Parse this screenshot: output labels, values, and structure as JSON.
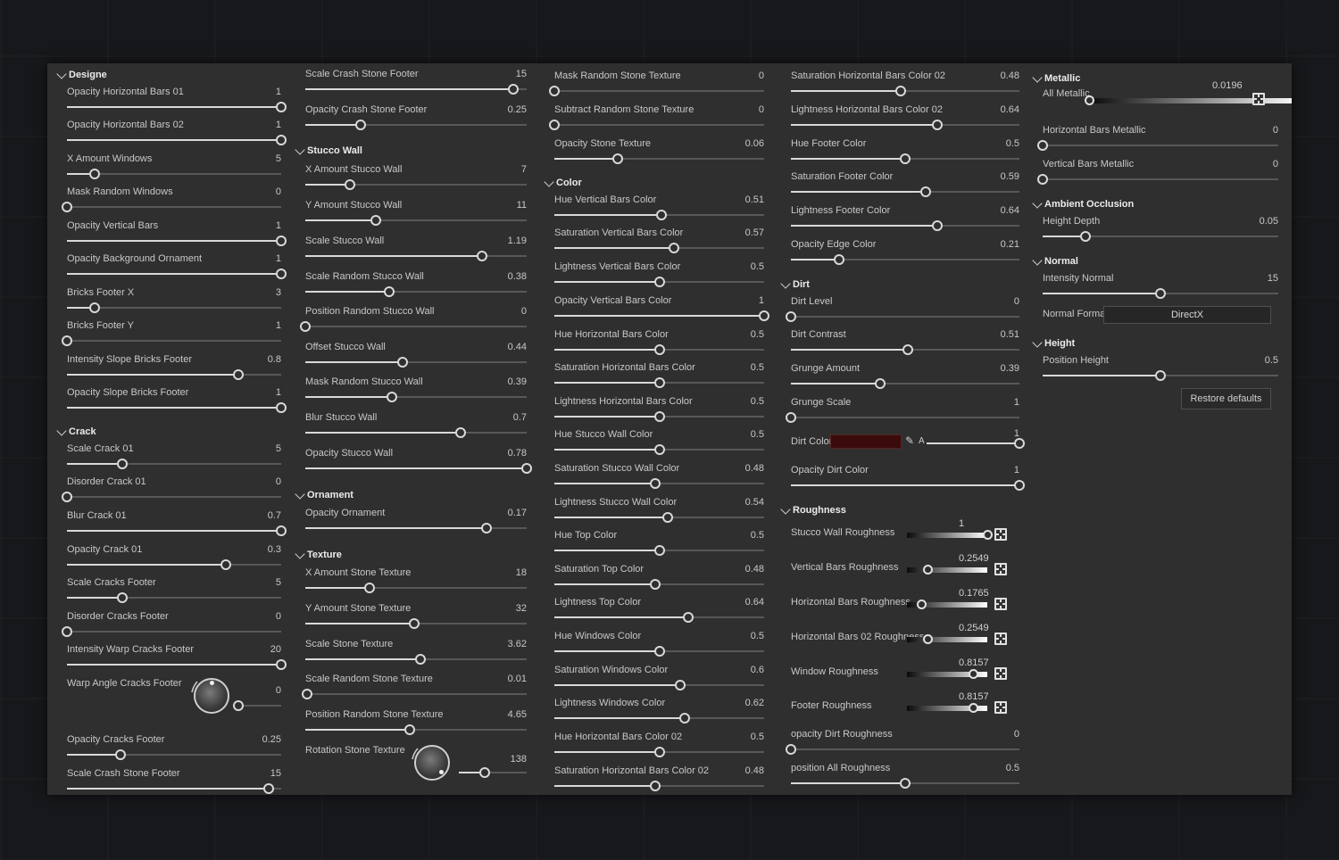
{
  "columns": [
    {
      "entries": [
        {
          "kind": "section",
          "title": "Designe"
        },
        {
          "kind": "slider",
          "label": "Opacity Horizontal Bars 01",
          "value": "1",
          "fraction": 1.0
        },
        {
          "kind": "slider",
          "label": "Opacity Horizontal Bars 02",
          "value": "1",
          "fraction": 1.0
        },
        {
          "kind": "slider",
          "label": "X Amount Windows",
          "value": "5",
          "fraction": 0.13
        },
        {
          "kind": "slider",
          "label": "Mask Random Windows",
          "value": "0",
          "fraction": 0.0
        },
        {
          "kind": "slider",
          "label": "Opacity Vertical Bars",
          "value": "1",
          "fraction": 1.0
        },
        {
          "kind": "slider",
          "label": "Opacity Background Ornament",
          "value": "1",
          "fraction": 1.0
        },
        {
          "kind": "slider",
          "label": "Bricks Footer X",
          "value": "3",
          "fraction": 0.13
        },
        {
          "kind": "slider",
          "label": "Bricks Footer Y",
          "value": "1",
          "fraction": 0.0
        },
        {
          "kind": "slider",
          "label": "Intensity Slope Bricks Footer",
          "value": "0.8",
          "fraction": 0.8
        },
        {
          "kind": "slider",
          "label": "Opacity Slope Bricks Footer",
          "value": "1",
          "fraction": 1.0
        },
        {
          "kind": "section",
          "title": "Crack"
        },
        {
          "kind": "slider",
          "label": "Scale Crack 01",
          "value": "5",
          "fraction": 0.26
        },
        {
          "kind": "slider",
          "label": "Disorder Crack 01",
          "value": "0",
          "fraction": 0.0
        },
        {
          "kind": "slider",
          "label": "Blur Crack 01",
          "value": "0.7",
          "fraction": 1.0
        },
        {
          "kind": "slider",
          "label": "Opacity Crack 01",
          "value": "0.3",
          "fraction": 0.74
        },
        {
          "kind": "slider",
          "label": "Scale Cracks Footer",
          "value": "5",
          "fraction": 0.26
        },
        {
          "kind": "slider",
          "label": "Disorder Cracks Footer",
          "value": "0",
          "fraction": 0.0
        },
        {
          "kind": "slider",
          "label": "Intensity Warp Cracks Footer",
          "value": "20",
          "fraction": 1.0
        },
        {
          "kind": "dial",
          "label": "Warp Angle Cracks Footer",
          "value": "0",
          "fraction": 0.0
        },
        {
          "kind": "slider",
          "label": "Opacity Cracks Footer",
          "value": "0.25",
          "fraction": 0.25
        },
        {
          "kind": "slider",
          "label": "Scale Crash Stone Footer",
          "value": "15",
          "fraction": 0.94
        }
      ]
    },
    {
      "entries": [
        {
          "kind": "slider",
          "label": "Scale Crash Stone Footer",
          "value": "15",
          "fraction": 0.94
        },
        {
          "kind": "slider",
          "label": "Opacity Crash Stone Footer",
          "value": "0.25",
          "fraction": 0.25
        },
        {
          "kind": "section",
          "title": "Stucco Wall"
        },
        {
          "kind": "slider",
          "label": "X Amount Stucco Wall",
          "value": "7",
          "fraction": 0.2
        },
        {
          "kind": "slider",
          "label": "Y Amount Stucco Wall",
          "value": "11",
          "fraction": 0.32
        },
        {
          "kind": "slider",
          "label": "Scale Stucco Wall",
          "value": "1.19",
          "fraction": 0.8
        },
        {
          "kind": "slider",
          "label": "Scale Random Stucco Wall",
          "value": "0.38",
          "fraction": 0.38
        },
        {
          "kind": "slider",
          "label": "Position Random Stucco Wall",
          "value": "0",
          "fraction": 0.0
        },
        {
          "kind": "slider",
          "label": "Offset Stucco Wall",
          "value": "0.44",
          "fraction": 0.44
        },
        {
          "kind": "slider",
          "label": "Mask Random Stucco Wall",
          "value": "0.39",
          "fraction": 0.39
        },
        {
          "kind": "slider",
          "label": "Blur Stucco Wall",
          "value": "0.7",
          "fraction": 0.7
        },
        {
          "kind": "slider",
          "label": "Opacity Stucco Wall",
          "value": "0.78",
          "fraction": 1.0
        },
        {
          "kind": "section",
          "title": "Ornament"
        },
        {
          "kind": "slider",
          "label": "Opacity Ornament",
          "value": "0.17",
          "fraction": 0.82
        },
        {
          "kind": "section",
          "title": "Texture"
        },
        {
          "kind": "slider",
          "label": "X Amount Stone Texture",
          "value": "18",
          "fraction": 0.29
        },
        {
          "kind": "slider",
          "label": "Y Amount Stone Texture",
          "value": "32",
          "fraction": 0.49
        },
        {
          "kind": "slider",
          "label": "Scale Stone Texture",
          "value": "3.62",
          "fraction": 0.52
        },
        {
          "kind": "slider",
          "label": "Scale Random Stone Texture",
          "value": "0.01",
          "fraction": 0.01
        },
        {
          "kind": "slider",
          "label": "Position Random Stone Texture",
          "value": "4.65",
          "fraction": 0.47
        },
        {
          "kind": "dial",
          "label": "Rotation Stone Texture",
          "value": "138",
          "fraction": 0.38
        }
      ]
    },
    {
      "entries": [
        {
          "kind": "slider",
          "label": "Mask Random Stone Texture",
          "value": "0",
          "fraction": 0.0
        },
        {
          "kind": "slider",
          "label": "Subtract Random Stone Texture",
          "value": "0",
          "fraction": 0.0
        },
        {
          "kind": "slider",
          "label": "Opacity Stone Texture",
          "value": "0.06",
          "fraction": 0.3
        },
        {
          "kind": "section",
          "title": "Color"
        },
        {
          "kind": "slider",
          "label": "Hue Vertical Bars Color",
          "value": "0.51",
          "fraction": 0.51
        },
        {
          "kind": "slider",
          "label": "Saturation Vertical Bars Color",
          "value": "0.57",
          "fraction": 0.57
        },
        {
          "kind": "slider",
          "label": "Lightness Vertical Bars Color",
          "value": "0.5",
          "fraction": 0.5
        },
        {
          "kind": "slider",
          "label": "Opacity Vertical Bars Color",
          "value": "1",
          "fraction": 1.0
        },
        {
          "kind": "slider",
          "label": "Hue Horizontal Bars Color",
          "value": "0.5",
          "fraction": 0.5
        },
        {
          "kind": "slider",
          "label": "Saturation Horizontal Bars Color",
          "value": "0.5",
          "fraction": 0.5
        },
        {
          "kind": "slider",
          "label": "Lightness Horizontal Bars Color",
          "value": "0.5",
          "fraction": 0.5
        },
        {
          "kind": "slider",
          "label": "Hue Stucco Wall Color",
          "value": "0.5",
          "fraction": 0.5
        },
        {
          "kind": "slider",
          "label": "Saturation Stucco Wall Color",
          "value": "0.48",
          "fraction": 0.48
        },
        {
          "kind": "slider",
          "label": "Lightness Stucco Wall Color",
          "value": "0.54",
          "fraction": 0.54
        },
        {
          "kind": "slider",
          "label": "Hue Top Color",
          "value": "0.5",
          "fraction": 0.5
        },
        {
          "kind": "slider",
          "label": "Saturation Top Color",
          "value": "0.48",
          "fraction": 0.48
        },
        {
          "kind": "slider",
          "label": "Lightness Top Color",
          "value": "0.64",
          "fraction": 0.64
        },
        {
          "kind": "slider",
          "label": "Hue Windows Color",
          "value": "0.5",
          "fraction": 0.5
        },
        {
          "kind": "slider",
          "label": "Saturation Windows Color",
          "value": "0.6",
          "fraction": 0.6
        },
        {
          "kind": "slider",
          "label": "Lightness Windows Color",
          "value": "0.62",
          "fraction": 0.62
        },
        {
          "kind": "slider",
          "label": "Hue  Horizontal Bars Color 02",
          "value": "0.5",
          "fraction": 0.5
        },
        {
          "kind": "slider",
          "label": "Saturation Horizontal Bars Color 02",
          "value": "0.48",
          "fraction": 0.48
        }
      ]
    },
    {
      "entries": [
        {
          "kind": "slider",
          "label": "Saturation Horizontal Bars Color 02",
          "value": "0.48",
          "fraction": 0.48
        },
        {
          "kind": "slider",
          "label": "Lightness Horizontal Bars Color 02",
          "value": "0.64",
          "fraction": 0.64
        },
        {
          "kind": "slider",
          "label": "Hue Footer Color",
          "value": "0.5",
          "fraction": 0.5
        },
        {
          "kind": "slider",
          "label": "Saturation Footer Color",
          "value": "0.59",
          "fraction": 0.59
        },
        {
          "kind": "slider",
          "label": "Lightness Footer Color",
          "value": "0.64",
          "fraction": 0.64
        },
        {
          "kind": "slider",
          "label": "Opacity Edge Color",
          "value": "0.21",
          "fraction": 0.21
        },
        {
          "kind": "section",
          "title": "Dirt"
        },
        {
          "kind": "slider",
          "label": "Dirt Level",
          "value": "0",
          "fraction": 0.0
        },
        {
          "kind": "slider",
          "label": "Dirt Contrast",
          "value": "0.51",
          "fraction": 0.51
        },
        {
          "kind": "slider",
          "label": "Grunge Amount",
          "value": "0.39",
          "fraction": 0.39
        },
        {
          "kind": "slider",
          "label": "Grunge Scale",
          "value": "1",
          "fraction": 0.0
        },
        {
          "kind": "color",
          "label": "Dirt Color",
          "alpha_label": "A",
          "value": "1",
          "fraction": 1.0,
          "swatch": "#3a0b0b"
        },
        {
          "kind": "slider",
          "label": "Opacity Dirt Color",
          "value": "1",
          "fraction": 1.0
        },
        {
          "kind": "section",
          "title": "Roughness"
        },
        {
          "kind": "gradient",
          "label": "Stucco Wall Roughness",
          "value": "1",
          "fraction": 1.0
        },
        {
          "kind": "gradient",
          "label": "Vertical Bars Roughness",
          "value": "0.2549",
          "fraction": 0.25
        },
        {
          "kind": "gradient",
          "label": "Horizontal Bars Roughness",
          "value": "0.1765",
          "fraction": 0.18
        },
        {
          "kind": "gradient",
          "label": "Horizontal Bars 02 Roughness",
          "value": "0.2549",
          "fraction": 0.25
        },
        {
          "kind": "gradient",
          "label": "Window Roughness",
          "value": "0.8157",
          "fraction": 0.82
        },
        {
          "kind": "gradient",
          "label": "Footer Roughness",
          "value": "0.8157",
          "fraction": 0.82
        },
        {
          "kind": "slider",
          "label": "opacity Dirt Roughness",
          "value": "0",
          "fraction": 0.0
        },
        {
          "kind": "slider",
          "label": "position All Roughness",
          "value": "0.5",
          "fraction": 0.5
        }
      ]
    },
    {
      "entries": [
        {
          "kind": "section",
          "title": "Metallic"
        },
        {
          "kind": "gradient-wide",
          "label": "All Metallic",
          "value": "0.0196",
          "fraction": 0.0
        },
        {
          "kind": "slider",
          "label": "Horizontal Bars Metallic",
          "value": "0",
          "fraction": 0.0
        },
        {
          "kind": "slider",
          "label": "Vertical Bars Metallic",
          "value": "0",
          "fraction": 0.0
        },
        {
          "kind": "section",
          "title": "Ambient Occlusion"
        },
        {
          "kind": "slider",
          "label": "Height Depth",
          "value": "0.05",
          "fraction": 0.18
        },
        {
          "kind": "section",
          "title": "Normal"
        },
        {
          "kind": "slider",
          "label": "Intensity Normal",
          "value": "15",
          "fraction": 0.5
        },
        {
          "kind": "dropdown",
          "label": "Normal Format",
          "value": "DirectX"
        },
        {
          "kind": "section",
          "title": "Height"
        },
        {
          "kind": "slider",
          "label": "Position Height",
          "value": "0.5",
          "fraction": 0.5
        },
        {
          "kind": "button",
          "label": "Restore defaults"
        }
      ]
    }
  ],
  "colors": {
    "panel": "#2f2f2f",
    "track": "#585858",
    "fill": "#d9d9d9",
    "dirt_swatch": "#3a0b0b"
  },
  "icons": {
    "section": "chevron-down-icon",
    "map": "texture-map-icon",
    "picker": "eyedropper-icon"
  }
}
